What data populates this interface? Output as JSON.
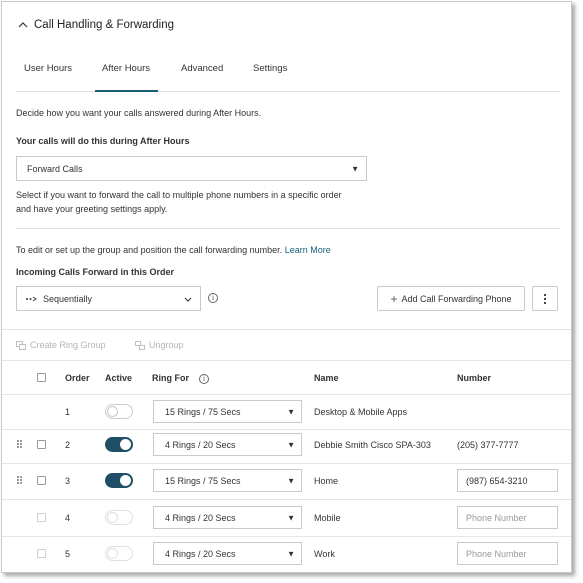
{
  "header": {
    "title": "Call Handling & Forwarding",
    "icon": "chevron-up-icon"
  },
  "tabs": [
    {
      "label": "User Hours",
      "active": false
    },
    {
      "label": "After Hours",
      "active": true
    },
    {
      "label": "Advanced",
      "active": false
    },
    {
      "label": "Settings",
      "active": false
    }
  ],
  "intro": "Decide how you want your calls answered during After Hours.",
  "calls_label": "Your calls will do this during After Hours",
  "call_action": {
    "value": "Forward Calls"
  },
  "call_action_help_line1": "Select if you want to forward the call to multiple phone numbers in a specific order",
  "call_action_help_line2": "and have your greeting settings apply.",
  "group_help": "To edit or set up the group and position the call forwarding number.",
  "learn_more": "Learn More",
  "order_label": "Incoming Calls Forward in this Order",
  "order_select": {
    "value": "Sequentially",
    "icon": "sequential-dots-icon"
  },
  "add_phone_button": "Add Call Forwarding Phone",
  "toolbar": {
    "create_ring_group": "Create Ring Group",
    "ungroup": "Ungroup"
  },
  "table": {
    "columns": {
      "order": "Order",
      "active": "Active",
      "ring_for": "Ring For",
      "name": "Name",
      "number": "Number"
    },
    "rows": [
      {
        "order": "1",
        "active": false,
        "ring_for": "15 Rings / 75 Secs",
        "name": "Desktop & Mobile Apps",
        "number": "",
        "placeholder": ""
      },
      {
        "order": "2",
        "active": true,
        "ring_for": "4 Rings / 20 Secs",
        "name": "Debbie Smith Cisco SPA-303",
        "number": "(205) 377-7777",
        "placeholder": ""
      },
      {
        "order": "3",
        "active": true,
        "ring_for": "15 Rings / 75 Secs",
        "name": "Home",
        "number": "(987) 654-3210",
        "placeholder": ""
      },
      {
        "order": "4",
        "active": false,
        "ring_for": "4 Rings / 20 Secs",
        "name": "Mobile",
        "number": "",
        "placeholder": "Phone Number"
      },
      {
        "order": "5",
        "active": false,
        "ring_for": "4 Rings / 20 Secs",
        "name": "Work",
        "number": "",
        "placeholder": "Phone Number"
      }
    ]
  },
  "colors": {
    "accent": "#1a5f7a",
    "toggle_on": "#1f4e66",
    "link": "#1a5f7a"
  }
}
